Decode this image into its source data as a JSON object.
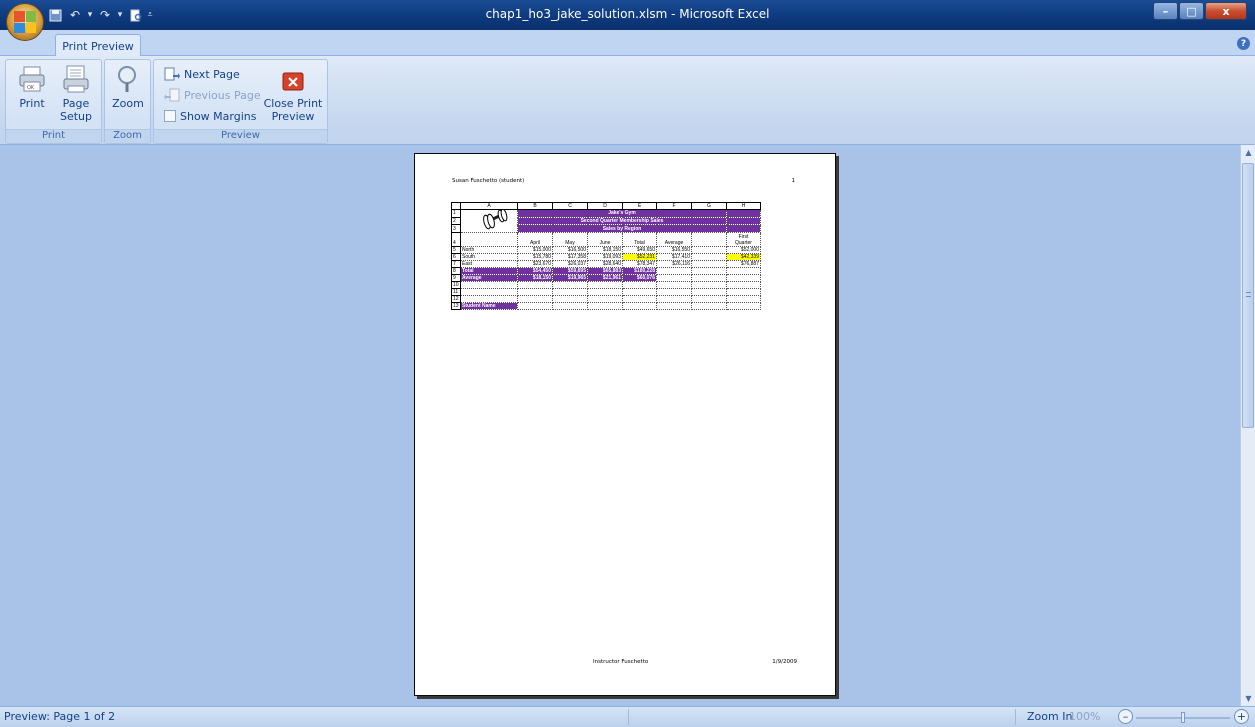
{
  "window": {
    "title": "chap1_ho3_jake_solution.xlsm - Microsoft Excel",
    "controls": {
      "minimize": "–",
      "maximize": "□",
      "close": "x"
    }
  },
  "ribbon": {
    "tab_label": "Print Preview",
    "help": "?",
    "groups": {
      "print": {
        "label": "Print",
        "print_label": "Print",
        "page_setup_label_1": "Page",
        "page_setup_label_2": "Setup"
      },
      "zoom": {
        "label": "Zoom",
        "zoom_label": "Zoom"
      },
      "preview": {
        "label": "Preview",
        "next_page": "Next Page",
        "previous_page": "Previous Page",
        "show_margins": "Show Margins",
        "close_label_1": "Close Print",
        "close_label_2": "Preview"
      }
    }
  },
  "page": {
    "header_left": "Susan Fuschetto (student)",
    "header_right": "1",
    "footer_center": "Instructor Fuschetto",
    "footer_right": "1/9/2009",
    "sheet": {
      "columns": [
        "A",
        "B",
        "C",
        "D",
        "E",
        "F",
        "G",
        "H"
      ],
      "title_1": "Jake's Gym",
      "title_2": "Second Quarter Membership Sales",
      "title_3": "Sales by Region",
      "headers": {
        "april": "April",
        "may": "May",
        "june": "June",
        "total": "Total",
        "average": "Average",
        "first_1": "First",
        "first_2": "Quarter"
      },
      "rows": [
        {
          "num": "5",
          "label": "North",
          "april": "$15,000",
          "may": "$16,500",
          "june": "$18,150",
          "total": "$49,650",
          "average": "$16,550",
          "first": "$52,000"
        },
        {
          "num": "6",
          "label": "South",
          "april": "$15,780",
          "may": "$17,358",
          "june": "$19,093",
          "total": "$52,231",
          "average": "$17,410",
          "first": "$42,339"
        },
        {
          "num": "7",
          "label": "East",
          "april": "$23,670",
          "may": "$26,037",
          "june": "$28,640",
          "total": "$78,347",
          "average": "$26,116",
          "first": "$76,887"
        }
      ],
      "total_row": {
        "num": "8",
        "label": "Total",
        "april": "$54,450",
        "may": "$59,895",
        "june": "$65,883",
        "total": "$180,228"
      },
      "average_row": {
        "num": "9",
        "label": "Average",
        "april": "$18,150",
        "may": "$19,965",
        "june": "$21,961",
        "total": "$60,076"
      },
      "empty_rows": [
        "10",
        "11",
        "12"
      ],
      "student_row": {
        "num": "13",
        "label": "Student Name"
      },
      "row_nums_title": [
        "1",
        "2",
        "3"
      ],
      "row_num_header": "4"
    }
  },
  "statusbar": {
    "left": "Preview: Page 1 of 2",
    "zoom_in": "Zoom In",
    "zoom_pct": "100%",
    "minus": "–",
    "plus": "+"
  }
}
